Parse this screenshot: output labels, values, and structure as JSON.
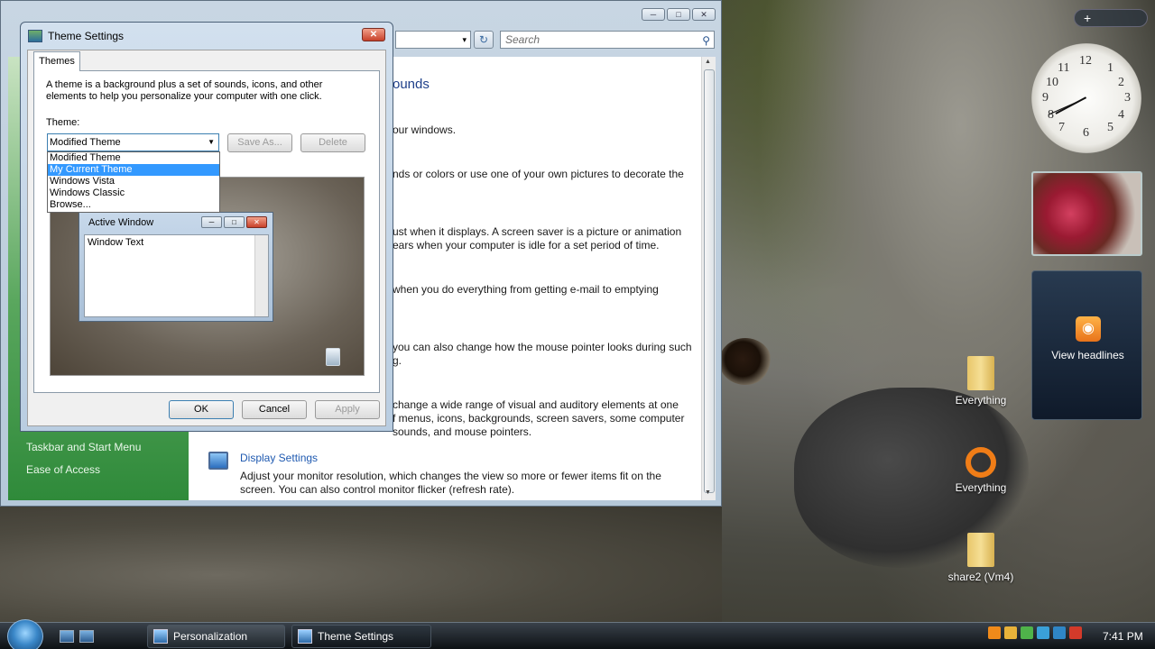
{
  "main_window": {
    "search_placeholder": "Search",
    "address_dropdown": "▾",
    "heading_partial": "ounds",
    "text_lines": [
      "our windows.",
      "nds or colors or use one of your own pictures to decorate the",
      "ust when it displays. A screen saver is a picture or animation",
      "ears when your computer is idle for a set period of time.",
      "when you do everything from getting e-mail to emptying",
      "you can also change how the mouse pointer looks during such",
      "g.",
      "change a wide range of visual and auditory elements at one",
      "f menus, icons, backgrounds, screen savers, some computer",
      "sounds, and mouse pointers."
    ],
    "sidebar_links": [
      "Taskbar and Start Menu",
      "Ease of Access"
    ],
    "display_settings_link": "Display Settings",
    "display_settings_desc": "Adjust your monitor resolution, which changes the view so more or fewer items fit on the screen. You can also control monitor flicker (refresh rate)."
  },
  "dialog": {
    "title": "Theme Settings",
    "tab": "Themes",
    "intro": "A theme is a background plus a set of sounds, icons, and other elements to help you personalize your computer with one click.",
    "theme_label": "Theme:",
    "selected_theme": "Modified Theme",
    "dropdown_options": [
      "Modified Theme",
      "My Current Theme",
      "Windows Vista",
      "Windows Classic",
      "Browse..."
    ],
    "highlighted_option": "My Current Theme",
    "save_as": "Save As...",
    "delete": "Delete",
    "active_window_title": "Active Window",
    "window_text": "Window Text",
    "ok": "OK",
    "cancel": "Cancel",
    "apply": "Apply"
  },
  "desktop": {
    "icons": [
      "Everything",
      "Everything",
      "share2 (Vm4)"
    ],
    "feed_label": "View headlines",
    "clock_numbers": [
      "12",
      "1",
      "2",
      "3",
      "4",
      "5",
      "6",
      "7",
      "8",
      "9",
      "10",
      "11"
    ],
    "clock_time": "7:41"
  },
  "taskbar": {
    "tasks": [
      "Personalization",
      "Theme Settings"
    ],
    "time": "7:41 PM"
  },
  "icon_names": [
    "search-icon",
    "refresh-icon",
    "close-icon",
    "minimize-icon",
    "maximize-icon",
    "rss-icon",
    "folder-icon",
    "start-orb-icon"
  ]
}
